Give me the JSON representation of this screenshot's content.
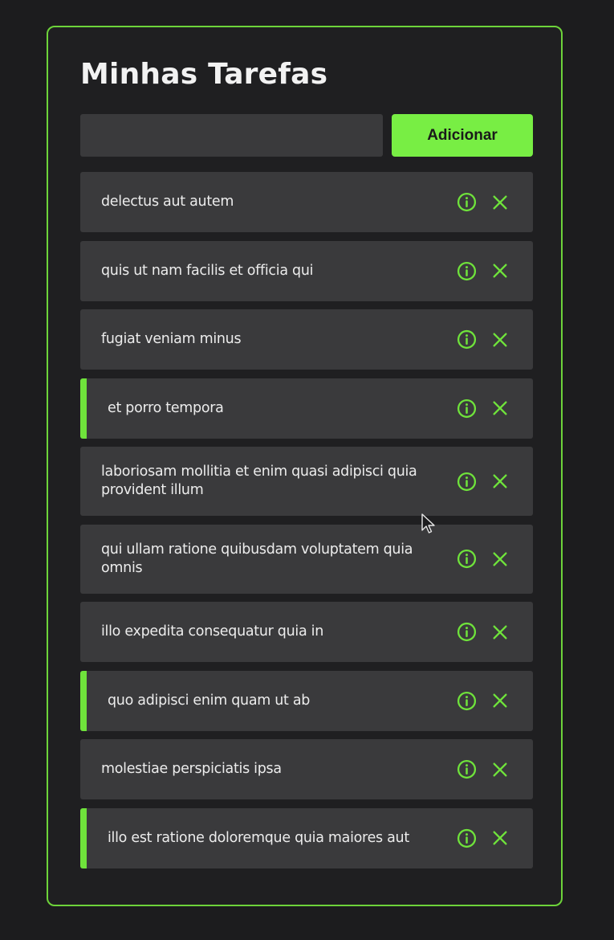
{
  "app": {
    "title": "Minhas Tarefas",
    "accent_color": "#78ee44"
  },
  "new_task": {
    "value": "",
    "placeholder": "",
    "button_label": "Adicionar"
  },
  "tasks": [
    {
      "text": "delectus aut autem",
      "completed": false
    },
    {
      "text": "quis ut nam facilis et officia qui",
      "completed": false
    },
    {
      "text": "fugiat veniam minus",
      "completed": false
    },
    {
      "text": "et porro tempora",
      "completed": true
    },
    {
      "text": "laboriosam mollitia et enim quasi adipisci quia provident illum",
      "completed": false
    },
    {
      "text": "qui ullam ratione quibusdam voluptatem quia omnis",
      "completed": false
    },
    {
      "text": "illo expedita consequatur quia in",
      "completed": false
    },
    {
      "text": "quo adipisci enim quam ut ab",
      "completed": true
    },
    {
      "text": "molestiae perspiciatis ipsa",
      "completed": false
    },
    {
      "text": "illo est ratione doloremque quia maiores aut",
      "completed": true
    }
  ],
  "icons": {
    "details": "info-icon",
    "remove": "close-icon"
  }
}
